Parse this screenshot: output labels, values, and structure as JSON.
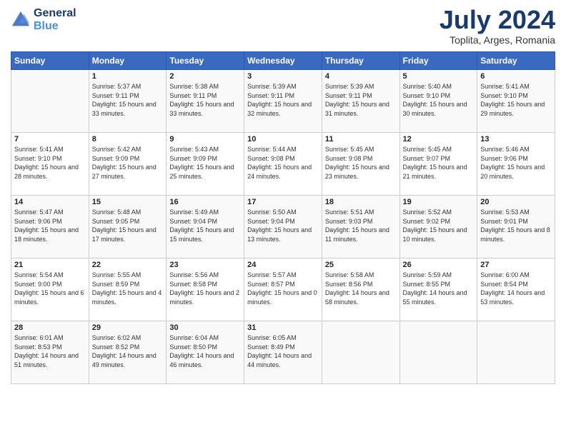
{
  "header": {
    "logo_line1": "General",
    "logo_line2": "Blue",
    "month_year": "July 2024",
    "location": "Toplita, Arges, Romania"
  },
  "weekdays": [
    "Sunday",
    "Monday",
    "Tuesday",
    "Wednesday",
    "Thursday",
    "Friday",
    "Saturday"
  ],
  "weeks": [
    [
      {
        "day": "",
        "empty": true
      },
      {
        "day": "1",
        "sunrise": "Sunrise: 5:37 AM",
        "sunset": "Sunset: 9:11 PM",
        "daylight": "Daylight: 15 hours and 33 minutes."
      },
      {
        "day": "2",
        "sunrise": "Sunrise: 5:38 AM",
        "sunset": "Sunset: 9:11 PM",
        "daylight": "Daylight: 15 hours and 33 minutes."
      },
      {
        "day": "3",
        "sunrise": "Sunrise: 5:39 AM",
        "sunset": "Sunset: 9:11 PM",
        "daylight": "Daylight: 15 hours and 32 minutes."
      },
      {
        "day": "4",
        "sunrise": "Sunrise: 5:39 AM",
        "sunset": "Sunset: 9:11 PM",
        "daylight": "Daylight: 15 hours and 31 minutes."
      },
      {
        "day": "5",
        "sunrise": "Sunrise: 5:40 AM",
        "sunset": "Sunset: 9:10 PM",
        "daylight": "Daylight: 15 hours and 30 minutes."
      },
      {
        "day": "6",
        "sunrise": "Sunrise: 5:41 AM",
        "sunset": "Sunset: 9:10 PM",
        "daylight": "Daylight: 15 hours and 29 minutes."
      }
    ],
    [
      {
        "day": "7",
        "sunrise": "Sunrise: 5:41 AM",
        "sunset": "Sunset: 9:10 PM",
        "daylight": "Daylight: 15 hours and 28 minutes."
      },
      {
        "day": "8",
        "sunrise": "Sunrise: 5:42 AM",
        "sunset": "Sunset: 9:09 PM",
        "daylight": "Daylight: 15 hours and 27 minutes."
      },
      {
        "day": "9",
        "sunrise": "Sunrise: 5:43 AM",
        "sunset": "Sunset: 9:09 PM",
        "daylight": "Daylight: 15 hours and 25 minutes."
      },
      {
        "day": "10",
        "sunrise": "Sunrise: 5:44 AM",
        "sunset": "Sunset: 9:08 PM",
        "daylight": "Daylight: 15 hours and 24 minutes."
      },
      {
        "day": "11",
        "sunrise": "Sunrise: 5:45 AM",
        "sunset": "Sunset: 9:08 PM",
        "daylight": "Daylight: 15 hours and 23 minutes."
      },
      {
        "day": "12",
        "sunrise": "Sunrise: 5:45 AM",
        "sunset": "Sunset: 9:07 PM",
        "daylight": "Daylight: 15 hours and 21 minutes."
      },
      {
        "day": "13",
        "sunrise": "Sunrise: 5:46 AM",
        "sunset": "Sunset: 9:06 PM",
        "daylight": "Daylight: 15 hours and 20 minutes."
      }
    ],
    [
      {
        "day": "14",
        "sunrise": "Sunrise: 5:47 AM",
        "sunset": "Sunset: 9:06 PM",
        "daylight": "Daylight: 15 hours and 18 minutes."
      },
      {
        "day": "15",
        "sunrise": "Sunrise: 5:48 AM",
        "sunset": "Sunset: 9:05 PM",
        "daylight": "Daylight: 15 hours and 17 minutes."
      },
      {
        "day": "16",
        "sunrise": "Sunrise: 5:49 AM",
        "sunset": "Sunset: 9:04 PM",
        "daylight": "Daylight: 15 hours and 15 minutes."
      },
      {
        "day": "17",
        "sunrise": "Sunrise: 5:50 AM",
        "sunset": "Sunset: 9:04 PM",
        "daylight": "Daylight: 15 hours and 13 minutes."
      },
      {
        "day": "18",
        "sunrise": "Sunrise: 5:51 AM",
        "sunset": "Sunset: 9:03 PM",
        "daylight": "Daylight: 15 hours and 11 minutes."
      },
      {
        "day": "19",
        "sunrise": "Sunrise: 5:52 AM",
        "sunset": "Sunset: 9:02 PM",
        "daylight": "Daylight: 15 hours and 10 minutes."
      },
      {
        "day": "20",
        "sunrise": "Sunrise: 5:53 AM",
        "sunset": "Sunset: 9:01 PM",
        "daylight": "Daylight: 15 hours and 8 minutes."
      }
    ],
    [
      {
        "day": "21",
        "sunrise": "Sunrise: 5:54 AM",
        "sunset": "Sunset: 9:00 PM",
        "daylight": "Daylight: 15 hours and 6 minutes."
      },
      {
        "day": "22",
        "sunrise": "Sunrise: 5:55 AM",
        "sunset": "Sunset: 8:59 PM",
        "daylight": "Daylight: 15 hours and 4 minutes."
      },
      {
        "day": "23",
        "sunrise": "Sunrise: 5:56 AM",
        "sunset": "Sunset: 8:58 PM",
        "daylight": "Daylight: 15 hours and 2 minutes."
      },
      {
        "day": "24",
        "sunrise": "Sunrise: 5:57 AM",
        "sunset": "Sunset: 8:57 PM",
        "daylight": "Daylight: 15 hours and 0 minutes."
      },
      {
        "day": "25",
        "sunrise": "Sunrise: 5:58 AM",
        "sunset": "Sunset: 8:56 PM",
        "daylight": "Daylight: 14 hours and 58 minutes."
      },
      {
        "day": "26",
        "sunrise": "Sunrise: 5:59 AM",
        "sunset": "Sunset: 8:55 PM",
        "daylight": "Daylight: 14 hours and 55 minutes."
      },
      {
        "day": "27",
        "sunrise": "Sunrise: 6:00 AM",
        "sunset": "Sunset: 8:54 PM",
        "daylight": "Daylight: 14 hours and 53 minutes."
      }
    ],
    [
      {
        "day": "28",
        "sunrise": "Sunrise: 6:01 AM",
        "sunset": "Sunset: 8:53 PM",
        "daylight": "Daylight: 14 hours and 51 minutes."
      },
      {
        "day": "29",
        "sunrise": "Sunrise: 6:02 AM",
        "sunset": "Sunset: 8:52 PM",
        "daylight": "Daylight: 14 hours and 49 minutes."
      },
      {
        "day": "30",
        "sunrise": "Sunrise: 6:04 AM",
        "sunset": "Sunset: 8:50 PM",
        "daylight": "Daylight: 14 hours and 46 minutes."
      },
      {
        "day": "31",
        "sunrise": "Sunrise: 6:05 AM",
        "sunset": "Sunset: 8:49 PM",
        "daylight": "Daylight: 14 hours and 44 minutes."
      },
      {
        "day": "",
        "empty": true
      },
      {
        "day": "",
        "empty": true
      },
      {
        "day": "",
        "empty": true
      }
    ]
  ]
}
